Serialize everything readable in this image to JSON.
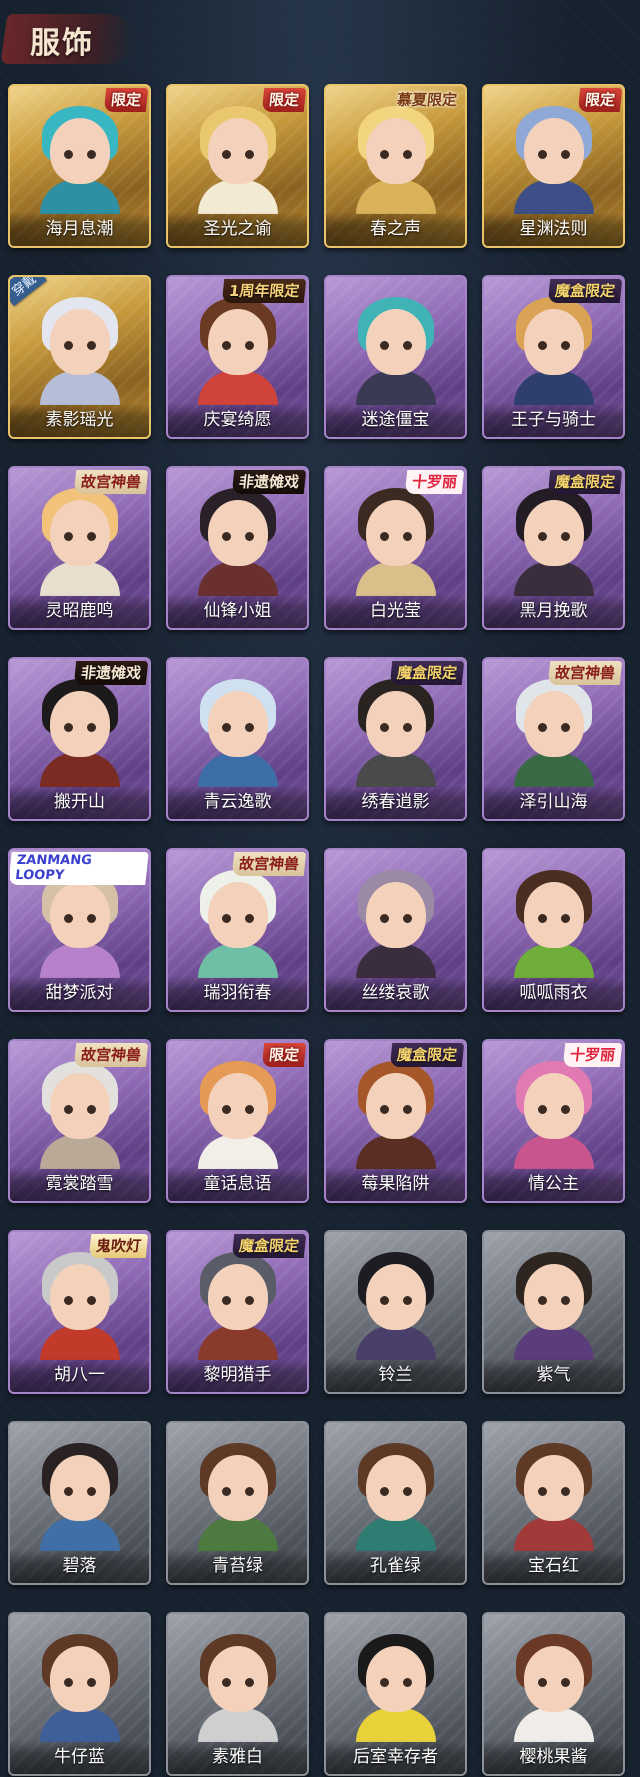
{
  "header": {
    "title": "服饰"
  },
  "wearing_label": "穿戴",
  "items": [
    {
      "name": "海月息潮",
      "tier": "gold",
      "tag": "限定",
      "tag_style": "default",
      "hair": "#38b7c2",
      "outfit": "#2f8fa3"
    },
    {
      "name": "圣光之谕",
      "tier": "gold",
      "tag": "限定",
      "tag_style": "default",
      "hair": "#e9c870",
      "outfit": "#f2ead3"
    },
    {
      "name": "春之声",
      "tier": "gold",
      "tag": "慕夏限定",
      "tag_style": "xiaxian",
      "hair": "#f2d57e",
      "outfit": "#d9b259"
    },
    {
      "name": "星渊法则",
      "tier": "gold",
      "tag": "限定",
      "tag_style": "default",
      "hair": "#8fa8d6",
      "outfit": "#3d4f86"
    },
    {
      "name": "素影瑶光",
      "tier": "gold",
      "tag": "",
      "tag_style": "",
      "wearing": true,
      "hair": "#e3e6ee",
      "outfit": "#b5bed6"
    },
    {
      "name": "庆宴绮愿",
      "tier": "purple",
      "tag": "1周年限定",
      "tag_style": "zhounian",
      "hair": "#6a3a22",
      "outfit": "#d0433a"
    },
    {
      "name": "迷途僵宝",
      "tier": "purple",
      "tag": "",
      "tag_style": "",
      "hair": "#3fb3b6",
      "outfit": "#3a3a55"
    },
    {
      "name": "王子与骑士",
      "tier": "purple",
      "tag": "魔盒限定",
      "tag_style": "mohe",
      "hair": "#d9a255",
      "outfit": "#2e3f6e"
    },
    {
      "name": "灵昭鹿鸣",
      "tier": "purple",
      "tag": "故宫神兽",
      "tag_style": "gugong",
      "hair": "#f2c27a",
      "outfit": "#e8dfcf"
    },
    {
      "name": "仙锋小姐",
      "tier": "purple",
      "tag": "非遗傩戏",
      "tag_style": "feiyi",
      "hair": "#2a2128",
      "outfit": "#6a2f2f"
    },
    {
      "name": "白光莹",
      "tier": "purple",
      "tag": "十罗丽",
      "tag_style": "shiluoli",
      "hair": "#3a2a22",
      "outfit": "#d9c08a"
    },
    {
      "name": "黑月挽歌",
      "tier": "purple",
      "tag": "魔盒限定",
      "tag_style": "mohe",
      "hair": "#241c24",
      "outfit": "#3a2d3d"
    },
    {
      "name": "搬开山",
      "tier": "purple",
      "tag": "非遗傩戏",
      "tag_style": "feiyi",
      "hair": "#1d1a1c",
      "outfit": "#7a2b22"
    },
    {
      "name": "青云逸歌",
      "tier": "purple",
      "tag": "",
      "tag_style": "",
      "hair": "#cfe0f0",
      "outfit": "#3e6ea8"
    },
    {
      "name": "绣春逍影",
      "tier": "purple",
      "tag": "魔盒限定",
      "tag_style": "mohe",
      "hair": "#2a2420",
      "outfit": "#4a4a4a"
    },
    {
      "name": "泽引山海",
      "tier": "purple",
      "tag": "故宫神兽",
      "tag_style": "gugong",
      "hair": "#dfe5e8",
      "outfit": "#3a6a45"
    },
    {
      "name": "甜梦派对",
      "tier": "purple",
      "tag": "ZANMANG LOOPY",
      "tag_style": "loopy",
      "hair": "#d4c1a8",
      "outfit": "#b782c9"
    },
    {
      "name": "瑞羽衔春",
      "tier": "purple",
      "tag": "故宫神兽",
      "tag_style": "gugong",
      "hair": "#eef0ea",
      "outfit": "#6fbfa6"
    },
    {
      "name": "丝缕哀歌",
      "tier": "purple",
      "tag": "",
      "tag_style": "",
      "hair": "#9a8aa6",
      "outfit": "#3a2e3e"
    },
    {
      "name": "呱呱雨衣",
      "tier": "purple",
      "tag": "",
      "tag_style": "",
      "hair": "#4a2e22",
      "outfit": "#6fae3a"
    },
    {
      "name": "霓裳踏雪",
      "tier": "purple",
      "tag": "故宫神兽",
      "tag_style": "gugong",
      "hair": "#e3e1dd",
      "outfit": "#b9a996"
    },
    {
      "name": "童话息语",
      "tier": "purple",
      "tag": "限定",
      "tag_style": "default",
      "hair": "#e59a55",
      "outfit": "#f1efe8"
    },
    {
      "name": "莓果陷阱",
      "tier": "purple",
      "tag": "魔盒限定",
      "tag_style": "mohe",
      "hair": "#a5572a",
      "outfit": "#5a2e22"
    },
    {
      "name": "情公主",
      "tier": "purple",
      "tag": "十罗丽",
      "tag_style": "shiluoli",
      "hair": "#e17ab3",
      "outfit": "#c9558f"
    },
    {
      "name": "胡八一",
      "tier": "purple",
      "tag": "鬼吹灯",
      "tag_style": "guichuideng",
      "hair": "#c9c9c9",
      "outfit": "#c13a2a"
    },
    {
      "name": "黎明猎手",
      "tier": "purple",
      "tag": "魔盒限定",
      "tag_style": "mohe",
      "hair": "#5a5d68",
      "outfit": "#8a3a2a"
    },
    {
      "name": "铃兰",
      "tier": "gray",
      "tag": "",
      "tag_style": "",
      "hair": "#1d1c22",
      "outfit": "#4a3f6a"
    },
    {
      "name": "紫气",
      "tier": "gray",
      "tag": "",
      "tag_style": "",
      "hair": "#2e2420",
      "outfit": "#5a3d7a"
    },
    {
      "name": "碧落",
      "tier": "gray",
      "tag": "",
      "tag_style": "",
      "hair": "#2a2222",
      "outfit": "#3f6fa6"
    },
    {
      "name": "青苔绿",
      "tier": "gray",
      "tag": "",
      "tag_style": "",
      "hair": "#5e3a26",
      "outfit": "#4d7a3e"
    },
    {
      "name": "孔雀绿",
      "tier": "gray",
      "tag": "",
      "tag_style": "",
      "hair": "#5e3a26",
      "outfit": "#2d7d72"
    },
    {
      "name": "宝石红",
      "tier": "gray",
      "tag": "",
      "tag_style": "",
      "hair": "#5e3a26",
      "outfit": "#a23a3a"
    },
    {
      "name": "牛仔蓝",
      "tier": "gray",
      "tag": "",
      "tag_style": "",
      "hair": "#5e3a26",
      "outfit": "#3f5f9a"
    },
    {
      "name": "素雅白",
      "tier": "gray",
      "tag": "",
      "tag_style": "",
      "hair": "#5e3a26",
      "outfit": "#cfcfcf"
    },
    {
      "name": "后室幸存者",
      "tier": "gray",
      "tag": "",
      "tag_style": "",
      "hair": "#1a1a1a",
      "outfit": "#e8d23a"
    },
    {
      "name": "樱桃果酱",
      "tier": "gray",
      "tag": "",
      "tag_style": "",
      "hair": "#6a3a26",
      "outfit": "#f0ece8"
    }
  ]
}
